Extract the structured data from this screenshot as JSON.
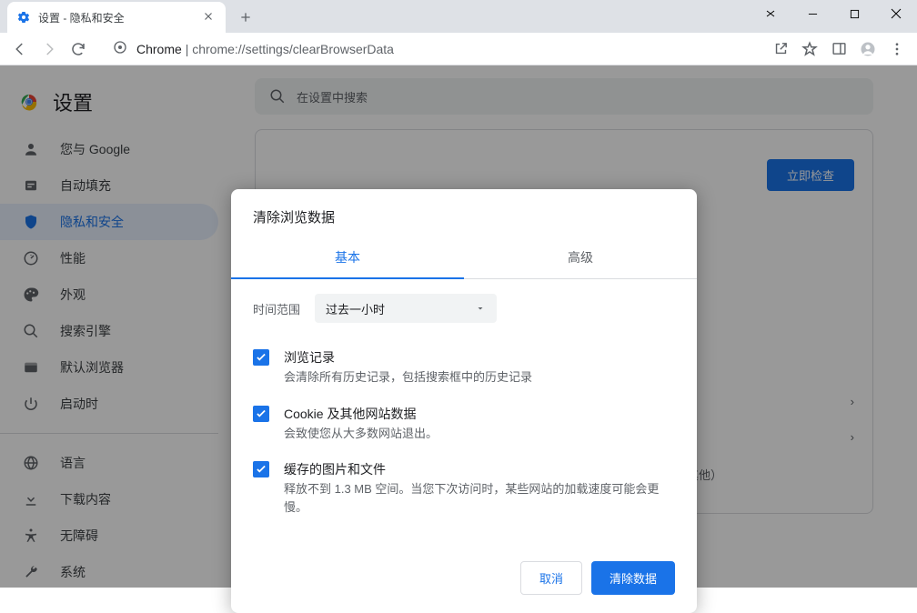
{
  "window": {
    "tab_title": "设置 - 隐私和安全",
    "url_prefix": "Chrome",
    "url": "chrome://settings/clearBrowserData"
  },
  "settings": {
    "title": "设置",
    "search_placeholder": "在设置中搜索",
    "sidebar": [
      {
        "icon": "person",
        "label": "您与 Google"
      },
      {
        "icon": "autofill",
        "label": "自动填充"
      },
      {
        "icon": "shield",
        "label": "隐私和安全",
        "selected": true
      },
      {
        "icon": "performance",
        "label": "性能"
      },
      {
        "icon": "palette",
        "label": "外观"
      },
      {
        "icon": "search",
        "label": "搜索引擎"
      },
      {
        "icon": "browser",
        "label": "默认浏览器"
      },
      {
        "icon": "power",
        "label": "启动时"
      }
    ],
    "sidebar2": [
      {
        "icon": "globe",
        "label": "语言"
      },
      {
        "icon": "download",
        "label": "下载内容"
      },
      {
        "icon": "accessibility",
        "label": "无障碍"
      },
      {
        "icon": "wrench",
        "label": "系统"
      }
    ],
    "check_button": "立即检查",
    "bottom_desc": "控制网站可以使用和显示什么信息（如位置信息、摄像头、弹出式窗口及其他）"
  },
  "modal": {
    "title": "清除浏览数据",
    "tabs": {
      "basic": "基本",
      "advanced": "高级"
    },
    "time_label": "时间范围",
    "time_value": "过去一小时",
    "items": [
      {
        "label": "浏览记录",
        "desc": "会清除所有历史记录，包括搜索框中的历史记录",
        "checked": true
      },
      {
        "label": "Cookie 及其他网站数据",
        "desc": "会致使您从大多数网站退出。",
        "checked": true
      },
      {
        "label": "缓存的图片和文件",
        "desc": "释放不到 1.3 MB 空间。当您下次访问时，某些网站的加载速度可能会更慢。",
        "checked": true
      }
    ],
    "cancel": "取消",
    "confirm": "清除数据"
  }
}
